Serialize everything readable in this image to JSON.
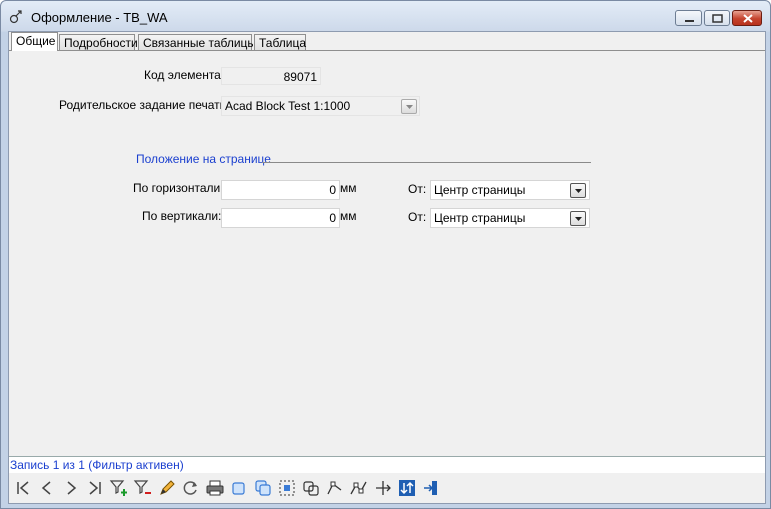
{
  "window": {
    "title": "Оформление - TB_WA"
  },
  "tabs": [
    {
      "label": "Общие",
      "active": true
    },
    {
      "label": "Подробности",
      "active": false
    },
    {
      "label": "Связанные таблицы",
      "active": false
    },
    {
      "label": "Таблица",
      "active": false
    }
  ],
  "form": {
    "element_code_label": "Код элемента:",
    "element_code_value": "89071",
    "parent_job_label": "Родительское задание печати:",
    "parent_job_value": "Acad Block Test 1:1000",
    "position_group_title": "Положение на странице",
    "horizontal_label": "По горизонтали:",
    "horizontal_value": "0",
    "horizontal_unit": "мм",
    "horizontal_from_label": "От:",
    "horizontal_from_value": "Центр страницы",
    "vertical_label": "По вертикали:",
    "vertical_value": "0",
    "vertical_unit": "мм",
    "vertical_from_label": "От:",
    "vertical_from_value": "Центр страницы"
  },
  "status": {
    "text": "Запись 1 из 1 (Фильтр активен)"
  },
  "toolbar": {
    "icons": [
      "first-record-icon",
      "previous-record-icon",
      "next-record-icon",
      "last-record-icon",
      "add-filter-icon",
      "remove-filter-icon",
      "edit-icon",
      "refresh-icon",
      "print-icon",
      "layer-icon",
      "copy-icon",
      "select-icon",
      "combine-icon",
      "node-icon",
      "multi-node-icon",
      "move-icon",
      "sort-icon",
      "exit-icon"
    ]
  },
  "colors": {
    "accent": "#1a3fcf",
    "close": "#c5432e"
  }
}
